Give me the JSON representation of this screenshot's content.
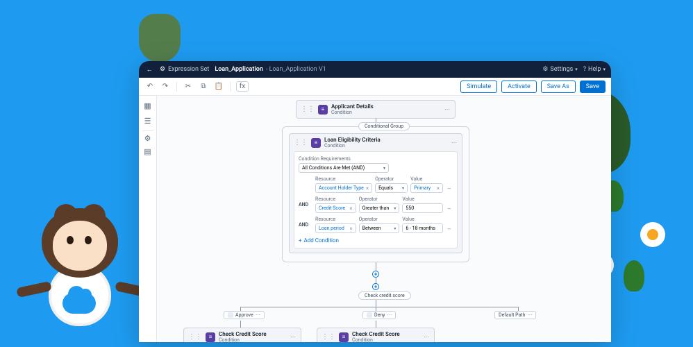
{
  "header": {
    "app_label": "Expression Set",
    "name": "Loan_Application",
    "sub": "Loan_Application V1",
    "settings": "Settings",
    "help": "Help"
  },
  "toolbar": {
    "buttons": {
      "simulate": "Simulate",
      "activate": "Activate",
      "save_as": "Save As",
      "save": "Save"
    }
  },
  "nodes": {
    "applicant": {
      "title": "Applicant Details",
      "type": "Condition"
    },
    "group_label": "Conditional Group",
    "eligibility": {
      "title": "Loan Eligibility Criteria",
      "type": "Condition",
      "requirements_label": "Condition Requirements",
      "requirements_value": "All Conditions Are Met (AND)",
      "columns": {
        "resource": "Resource",
        "operator": "Operator",
        "value": "Value"
      },
      "rows": [
        {
          "join": "",
          "resource": "Account Holder Type",
          "operator": "Equals",
          "value": "Primary"
        },
        {
          "join": "AND",
          "resource": "Credit Score",
          "operator": "Greater than",
          "value": "550"
        },
        {
          "join": "AND",
          "resource": "Loan period",
          "operator": "Between",
          "value": "6 - 18 months"
        }
      ],
      "add_condition": "Add Condition"
    },
    "decision_label": "Check credit score",
    "branches": {
      "approve": "Approve",
      "deny": "Deny",
      "default": "Default Path"
    },
    "check_credit_left": {
      "title": "Check Credit Score",
      "type": "Condition"
    },
    "check_credit_mid": {
      "title": "Check Credit Score",
      "type": "Condition"
    }
  },
  "icons": {
    "fx": "fx"
  }
}
